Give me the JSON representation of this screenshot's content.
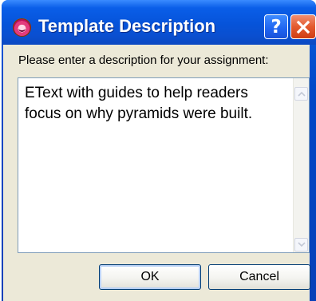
{
  "window": {
    "title": "Template Description",
    "help_symbol": "?",
    "icon": "app-face-icon"
  },
  "dialog": {
    "prompt": "Please enter a description for your assignment:",
    "description_value": "EText with guides to help readers\nfocus on why pyramids were built.",
    "ok_label": "OK",
    "cancel_label": "Cancel"
  },
  "colors": {
    "titlebar": "#0653d9",
    "client_background": "#ece9d8",
    "close_button": "#e35a2e"
  }
}
